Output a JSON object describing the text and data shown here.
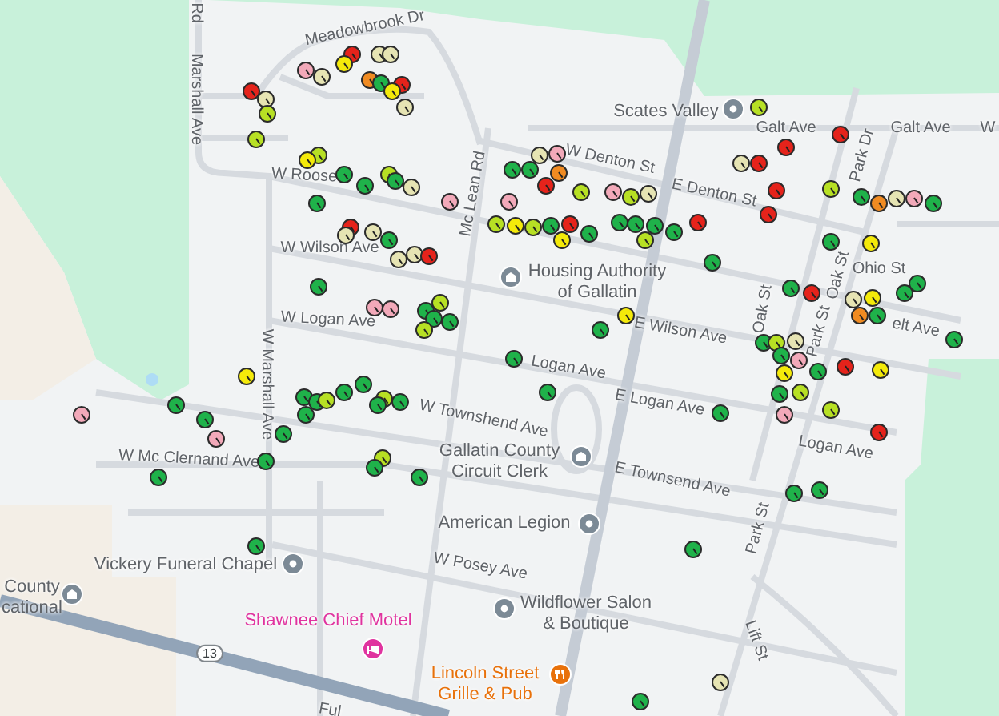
{
  "map": {
    "labels": [
      {
        "kind": "street",
        "lines": [
          "Rd"
        ]
      },
      {
        "kind": "street",
        "lines": [
          "Meadowbrook Dr"
        ]
      },
      {
        "kind": "street",
        "lines": [
          "Marshall Ave"
        ]
      },
      {
        "kind": "landmark",
        "lines": [
          "Scates Valley"
        ]
      },
      {
        "kind": "street",
        "lines": [
          "Galt Ave"
        ]
      },
      {
        "kind": "street",
        "lines": [
          "Galt Ave"
        ]
      },
      {
        "kind": "street",
        "lines": [
          "W"
        ]
      },
      {
        "kind": "street",
        "lines": [
          "Park Dr"
        ]
      },
      {
        "kind": "street",
        "lines": [
          "W Denton St"
        ]
      },
      {
        "kind": "street",
        "lines": [
          "W Roose"
        ]
      },
      {
        "kind": "street",
        "lines": [
          "E Denton St"
        ]
      },
      {
        "kind": "street",
        "lines": [
          "Mc Lean Rd"
        ]
      },
      {
        "kind": "street",
        "lines": [
          "W Wilson Ave"
        ]
      },
      {
        "kind": "street",
        "lines": [
          "Ohio St"
        ]
      },
      {
        "kind": "landmark",
        "lines": [
          "Housing Authority",
          "of Gallatin"
        ]
      },
      {
        "kind": "street",
        "lines": [
          "Oak St"
        ]
      },
      {
        "kind": "street",
        "lines": [
          "Oak St"
        ]
      },
      {
        "kind": "street",
        "lines": [
          "Park St"
        ]
      },
      {
        "kind": "street",
        "lines": [
          "elt Ave"
        ]
      },
      {
        "kind": "street",
        "lines": [
          "W Logan Ave"
        ]
      },
      {
        "kind": "street",
        "lines": [
          "E Wilson Ave"
        ]
      },
      {
        "kind": "street",
        "lines": [
          "Logan Ave"
        ]
      },
      {
        "kind": "street",
        "lines": [
          "E Logan Ave"
        ]
      },
      {
        "kind": "street",
        "lines": [
          "W Townshend Ave"
        ]
      },
      {
        "kind": "street",
        "lines": [
          "Logan Ave"
        ]
      },
      {
        "kind": "street",
        "lines": [
          "W Marshall Ave"
        ]
      },
      {
        "kind": "street",
        "lines": [
          "W Mc Clernand Ave"
        ]
      },
      {
        "kind": "landmark",
        "lines": [
          "Gallatin County",
          "Circuit Clerk"
        ]
      },
      {
        "kind": "street",
        "lines": [
          "E Townsend Ave"
        ]
      },
      {
        "kind": "landmark",
        "lines": [
          "American Legion"
        ]
      },
      {
        "kind": "street",
        "lines": [
          "Park St"
        ]
      },
      {
        "kind": "street",
        "lines": [
          "W Posey Ave"
        ]
      },
      {
        "kind": "landmark",
        "lines": [
          "Vickery Funeral Chapel"
        ]
      },
      {
        "kind": "landmark",
        "lines": [
          "County",
          "cational"
        ]
      },
      {
        "kind": "lodging",
        "lines": [
          "Shawnee Chief Motel"
        ]
      },
      {
        "kind": "landmark",
        "lines": [
          "Wildflower Salon",
          "& Boutique"
        ]
      },
      {
        "kind": "street",
        "lines": [
          "Lift St"
        ]
      },
      {
        "kind": "route",
        "lines": [
          "13"
        ]
      },
      {
        "kind": "food",
        "lines": [
          "Lincoln Street",
          "Grille & Pub"
        ]
      },
      {
        "kind": "street",
        "lines": [
          "Ful"
        ]
      }
    ],
    "pins": [
      {
        "color": "#f2a9b9"
      },
      {
        "color": "#e6e4b3"
      },
      {
        "color": "#e5231b"
      },
      {
        "color": "#f4ea0a"
      },
      {
        "color": "#e6e4b3"
      },
      {
        "color": "#e6e4b3"
      },
      {
        "color": "#f08b22"
      },
      {
        "color": "#1fb24a"
      },
      {
        "color": "#e5231b"
      },
      {
        "color": "#f4ea0a"
      },
      {
        "color": "#e6e4b3"
      },
      {
        "color": "#e5231b"
      },
      {
        "color": "#e6e4b3"
      },
      {
        "color": "#b7e024"
      },
      {
        "color": "#b7e024"
      },
      {
        "color": "#b7e024"
      },
      {
        "color": "#f4ea0a"
      },
      {
        "color": "#1fb24a"
      },
      {
        "color": "#1fb24a"
      },
      {
        "color": "#b7e024"
      },
      {
        "color": "#1fb24a"
      },
      {
        "color": "#e6e4b3"
      },
      {
        "color": "#1fb24a"
      },
      {
        "color": "#e5231b"
      },
      {
        "color": "#e6e4b3"
      },
      {
        "color": "#e6e4b3"
      },
      {
        "color": "#1fb24a"
      },
      {
        "color": "#e6e4b3"
      },
      {
        "color": "#e6e4b3"
      },
      {
        "color": "#e5231b"
      },
      {
        "color": "#1fb24a"
      },
      {
        "color": "#f2a9b9"
      },
      {
        "color": "#f2a9b9"
      },
      {
        "color": "#b7e024"
      },
      {
        "color": "#1fb24a"
      },
      {
        "color": "#1fb24a"
      },
      {
        "color": "#1fb24a"
      },
      {
        "color": "#b7e024"
      },
      {
        "color": "#f2a9b9"
      },
      {
        "color": "#b7e024"
      },
      {
        "color": "#b7e024"
      },
      {
        "color": "#e5231b"
      },
      {
        "color": "#e5231b"
      },
      {
        "color": "#1fb24a"
      },
      {
        "color": "#1fb24a"
      },
      {
        "color": "#e6e4b3"
      },
      {
        "color": "#f2a9b9"
      },
      {
        "color": "#f08b22"
      },
      {
        "color": "#e5231b"
      },
      {
        "color": "#b7e024"
      },
      {
        "color": "#f2a9b9"
      },
      {
        "color": "#b7e024"
      },
      {
        "color": "#e6e4b3"
      },
      {
        "color": "#e6e4b3"
      },
      {
        "color": "#e5231b"
      },
      {
        "color": "#e5231b"
      },
      {
        "color": "#e5231b"
      },
      {
        "color": "#e5231b"
      },
      {
        "color": "#b7e024"
      },
      {
        "color": "#1fb24a"
      },
      {
        "color": "#f08b22"
      },
      {
        "color": "#e6e4b3"
      },
      {
        "color": "#f2a9b9"
      },
      {
        "color": "#1fb24a"
      },
      {
        "color": "#f2a9b9"
      },
      {
        "color": "#f4ea0a"
      },
      {
        "color": "#b7e024"
      },
      {
        "color": "#1fb24a"
      },
      {
        "color": "#e5231b"
      },
      {
        "color": "#f4ea0a"
      },
      {
        "color": "#1fb24a"
      },
      {
        "color": "#1fb24a"
      },
      {
        "color": "#1fb24a"
      },
      {
        "color": "#b7e024"
      },
      {
        "color": "#1fb24a"
      },
      {
        "color": "#1fb24a"
      },
      {
        "color": "#1fb24a"
      },
      {
        "color": "#f4ea0a"
      },
      {
        "color": "#1fb24a"
      },
      {
        "color": "#1fb24a"
      },
      {
        "color": "#f4ea0a"
      },
      {
        "color": "#1fb24a"
      },
      {
        "color": "#e5231b"
      },
      {
        "color": "#e6e4b3"
      },
      {
        "color": "#f08b22"
      },
      {
        "color": "#f4ea0a"
      },
      {
        "color": "#1fb24a"
      },
      {
        "color": "#1fb24a"
      },
      {
        "color": "#1fb24a"
      },
      {
        "color": "#1fb24a"
      },
      {
        "color": "#1fb24a"
      },
      {
        "color": "#b7e024"
      },
      {
        "color": "#e6e4b3"
      },
      {
        "color": "#1fb24a"
      },
      {
        "color": "#f4ea0a"
      },
      {
        "color": "#f2a9b9"
      },
      {
        "color": "#1fb24a"
      },
      {
        "color": "#1fb24a"
      },
      {
        "color": "#1fb24a"
      },
      {
        "color": "#1fb24a"
      },
      {
        "color": "#1fb24a"
      },
      {
        "color": "#b7e024"
      },
      {
        "color": "#f2a9b9"
      },
      {
        "color": "#b7e024"
      },
      {
        "color": "#e5231b"
      },
      {
        "color": "#f4ea0a"
      },
      {
        "color": "#e5231b"
      },
      {
        "color": "#1fb24a"
      },
      {
        "color": "#1fb24a"
      },
      {
        "color": "#1fb24a"
      },
      {
        "color": "#e6e4b3"
      },
      {
        "color": "#1fb24a"
      },
      {
        "color": "#f4ea0a"
      },
      {
        "color": "#f2a9b9"
      },
      {
        "color": "#1fb24a"
      },
      {
        "color": "#1fb24a"
      },
      {
        "color": "#f2a9b9"
      },
      {
        "color": "#1fb24a"
      },
      {
        "color": "#1fb24a"
      },
      {
        "color": "#1fb24a"
      },
      {
        "color": "#1fb24a"
      },
      {
        "color": "#1fb24a"
      },
      {
        "color": "#b7e024"
      },
      {
        "color": "#1fb24a"
      },
      {
        "color": "#1fb24a"
      },
      {
        "color": "#1fb24a"
      },
      {
        "color": "#b7e024"
      },
      {
        "color": "#1fb24a"
      },
      {
        "color": "#1fb24a"
      },
      {
        "color": "#b7e024"
      },
      {
        "color": "#1fb24a"
      },
      {
        "color": "#1fb24a"
      },
      {
        "color": "#1fb24a"
      }
    ]
  }
}
